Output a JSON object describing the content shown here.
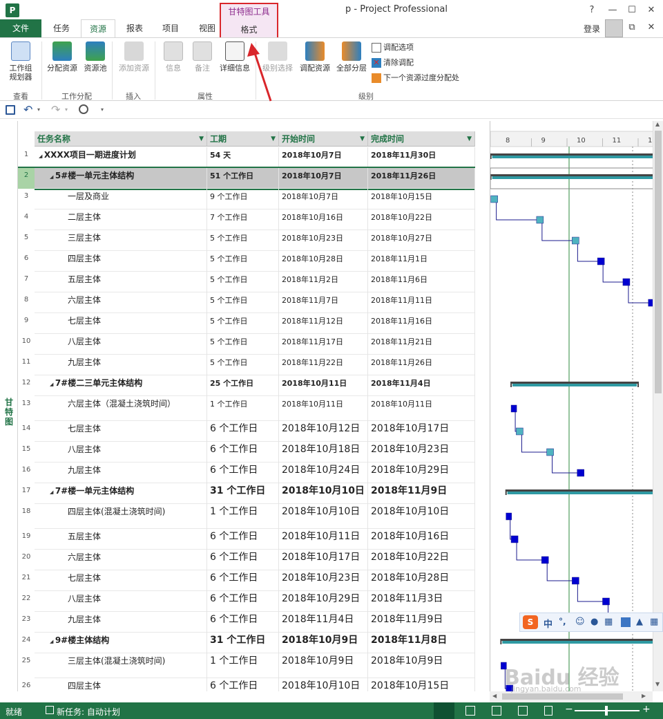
{
  "window": {
    "title": "p - Project Professional",
    "app_icon": "P",
    "help": "?",
    "minimize": "—",
    "restore": "☐",
    "close": "✕"
  },
  "context_group": {
    "label": "甘特图工具",
    "tab": "格式"
  },
  "tabs": {
    "file": "文件",
    "task": "任务",
    "resource": "资源",
    "report": "报表",
    "project": "项目",
    "view": "视图"
  },
  "account": {
    "login": "登录"
  },
  "ribbon": {
    "work_planner": "工作组\n规划器",
    "assign_resource": "分配资源",
    "resource_pool": "资源池",
    "add_resource": "添加资源",
    "info": "信息",
    "notes": "备注",
    "details": "详细信息",
    "level_selection": "级别选择",
    "level_resource": "调配资源",
    "level_all": "全部分层",
    "leveling_options": "调配选项",
    "clear_leveling": "清除调配",
    "next_overallocation": "下一个资源过度分配处",
    "groups": {
      "view": "查看",
      "assignments": "工作分配",
      "insert": "插入",
      "properties": "属性",
      "level": "级别"
    }
  },
  "side_view_label": "甘特图",
  "columns": {
    "name": "任务名称",
    "duration": "工期",
    "start": "开始时间",
    "finish": "完成时间"
  },
  "timescale": [
    "8",
    "9",
    "10",
    "11",
    "1"
  ],
  "rows": [
    {
      "id": "1",
      "name": "XXXX项目一期进度计划",
      "duration": "54 天",
      "start": "2018年10月7日",
      "finish": "2018年11月30日",
      "level": 0,
      "summary": true
    },
    {
      "id": "2",
      "name": "5#楼一单元主体结构",
      "duration": "51 个工作日",
      "start": "2018年10月7日",
      "finish": "2018年11月26日",
      "level": 1,
      "summary": true
    },
    {
      "id": "3",
      "name": "一层及商业",
      "duration": "9 个工作日",
      "start": "2018年10月7日",
      "finish": "2018年10月15日",
      "level": 2
    },
    {
      "id": "4",
      "name": "二层主体",
      "duration": "7 个工作日",
      "start": "2018年10月16日",
      "finish": "2018年10月22日",
      "level": 2
    },
    {
      "id": "5",
      "name": "三层主体",
      "duration": "5 个工作日",
      "start": "2018年10月23日",
      "finish": "2018年10月27日",
      "level": 2
    },
    {
      "id": "6",
      "name": "四层主体",
      "duration": "5 个工作日",
      "start": "2018年10月28日",
      "finish": "2018年11月1日",
      "level": 2
    },
    {
      "id": "7",
      "name": "五层主体",
      "duration": "5 个工作日",
      "start": "2018年11月2日",
      "finish": "2018年11月6日",
      "level": 2
    },
    {
      "id": "8",
      "name": "六层主体",
      "duration": "5 个工作日",
      "start": "2018年11月7日",
      "finish": "2018年11月11日",
      "level": 2
    },
    {
      "id": "9",
      "name": "七层主体",
      "duration": "5 个工作日",
      "start": "2018年11月12日",
      "finish": "2018年11月16日",
      "level": 2
    },
    {
      "id": "10",
      "name": "八层主体",
      "duration": "5 个工作日",
      "start": "2018年11月17日",
      "finish": "2018年11月21日",
      "level": 2
    },
    {
      "id": "11",
      "name": "九层主体",
      "duration": "5 个工作日",
      "start": "2018年11月22日",
      "finish": "2018年11月26日",
      "level": 2
    },
    {
      "id": "12",
      "name": "7#楼二三单元主体结构",
      "duration": "25 个工作日",
      "start": "2018年10月11日",
      "finish": "2018年11月4日",
      "level": 1,
      "summary": true
    },
    {
      "id": "13",
      "name": "六层主体（混凝土浇筑时间）",
      "duration": "1 个工作日",
      "start": "2018年10月11日",
      "finish": "2018年10月11日",
      "level": 2,
      "tall": true
    },
    {
      "id": "14",
      "name": "七层主体",
      "duration": "6 个工作日",
      "start": "2018年10月12日",
      "finish": "2018年10月17日",
      "level": 2,
      "big": true
    },
    {
      "id": "15",
      "name": "八层主体",
      "duration": "6 个工作日",
      "start": "2018年10月18日",
      "finish": "2018年10月23日",
      "level": 2,
      "big": true
    },
    {
      "id": "16",
      "name": "九层主体",
      "duration": "6 个工作日",
      "start": "2018年10月24日",
      "finish": "2018年10月29日",
      "level": 2,
      "big": true
    },
    {
      "id": "17",
      "name": "7#楼一单元主体结构",
      "duration": "31 个工作日",
      "start": "2018年10月10日",
      "finish": "2018年11月9日",
      "level": 1,
      "summary": true,
      "big": true
    },
    {
      "id": "18",
      "name": "四层主体(混凝土浇筑时间)",
      "duration": "1 个工作日",
      "start": "2018年10月10日",
      "finish": "2018年10月10日",
      "level": 2,
      "tall": true,
      "big": true
    },
    {
      "id": "19",
      "name": "五层主体",
      "duration": "6 个工作日",
      "start": "2018年10月11日",
      "finish": "2018年10月16日",
      "level": 2,
      "big": true
    },
    {
      "id": "20",
      "name": "六层主体",
      "duration": "6 个工作日",
      "start": "2018年10月17日",
      "finish": "2018年10月22日",
      "level": 2,
      "big": true
    },
    {
      "id": "21",
      "name": "七层主体",
      "duration": "6 个工作日",
      "start": "2018年10月23日",
      "finish": "2018年10月28日",
      "level": 2,
      "big": true
    },
    {
      "id": "22",
      "name": "八层主体",
      "duration": "6 个工作日",
      "start": "2018年10月29日",
      "finish": "2018年11月3日",
      "level": 2,
      "big": true
    },
    {
      "id": "23",
      "name": "九层主体",
      "duration": "6 个工作日",
      "start": "2018年11月4日",
      "finish": "2018年11月9日",
      "level": 2,
      "big": true
    },
    {
      "id": "24",
      "name": "9#楼主体结构",
      "duration": "31 个工作日",
      "start": "2018年10月9日",
      "finish": "2018年11月8日",
      "level": 1,
      "summary": true,
      "big": true
    },
    {
      "id": "25",
      "name": "三层主体(混凝土浇筑时间)",
      "duration": "1 个工作日",
      "start": "2018年10月9日",
      "finish": "2018年10月9日",
      "level": 2,
      "tall": true,
      "big": true
    },
    {
      "id": "26",
      "name": "四层主体",
      "duration": "6 个工作日",
      "start": "2018年10月10日",
      "finish": "2018年10月15日",
      "level": 2,
      "big": true
    }
  ],
  "ime": {
    "label": "中",
    "punct": "°,"
  },
  "watermark": {
    "brand": "Baidu 经验",
    "url": "jingyan.baidu.com"
  },
  "status": {
    "ready": "就绪",
    "new_task": "新任务: 自动计划"
  },
  "colors": {
    "brand_green": "#217346",
    "context_red": "#d9262b",
    "task_blue": "#0000d0",
    "summary_teal": "#2f9aa3"
  }
}
